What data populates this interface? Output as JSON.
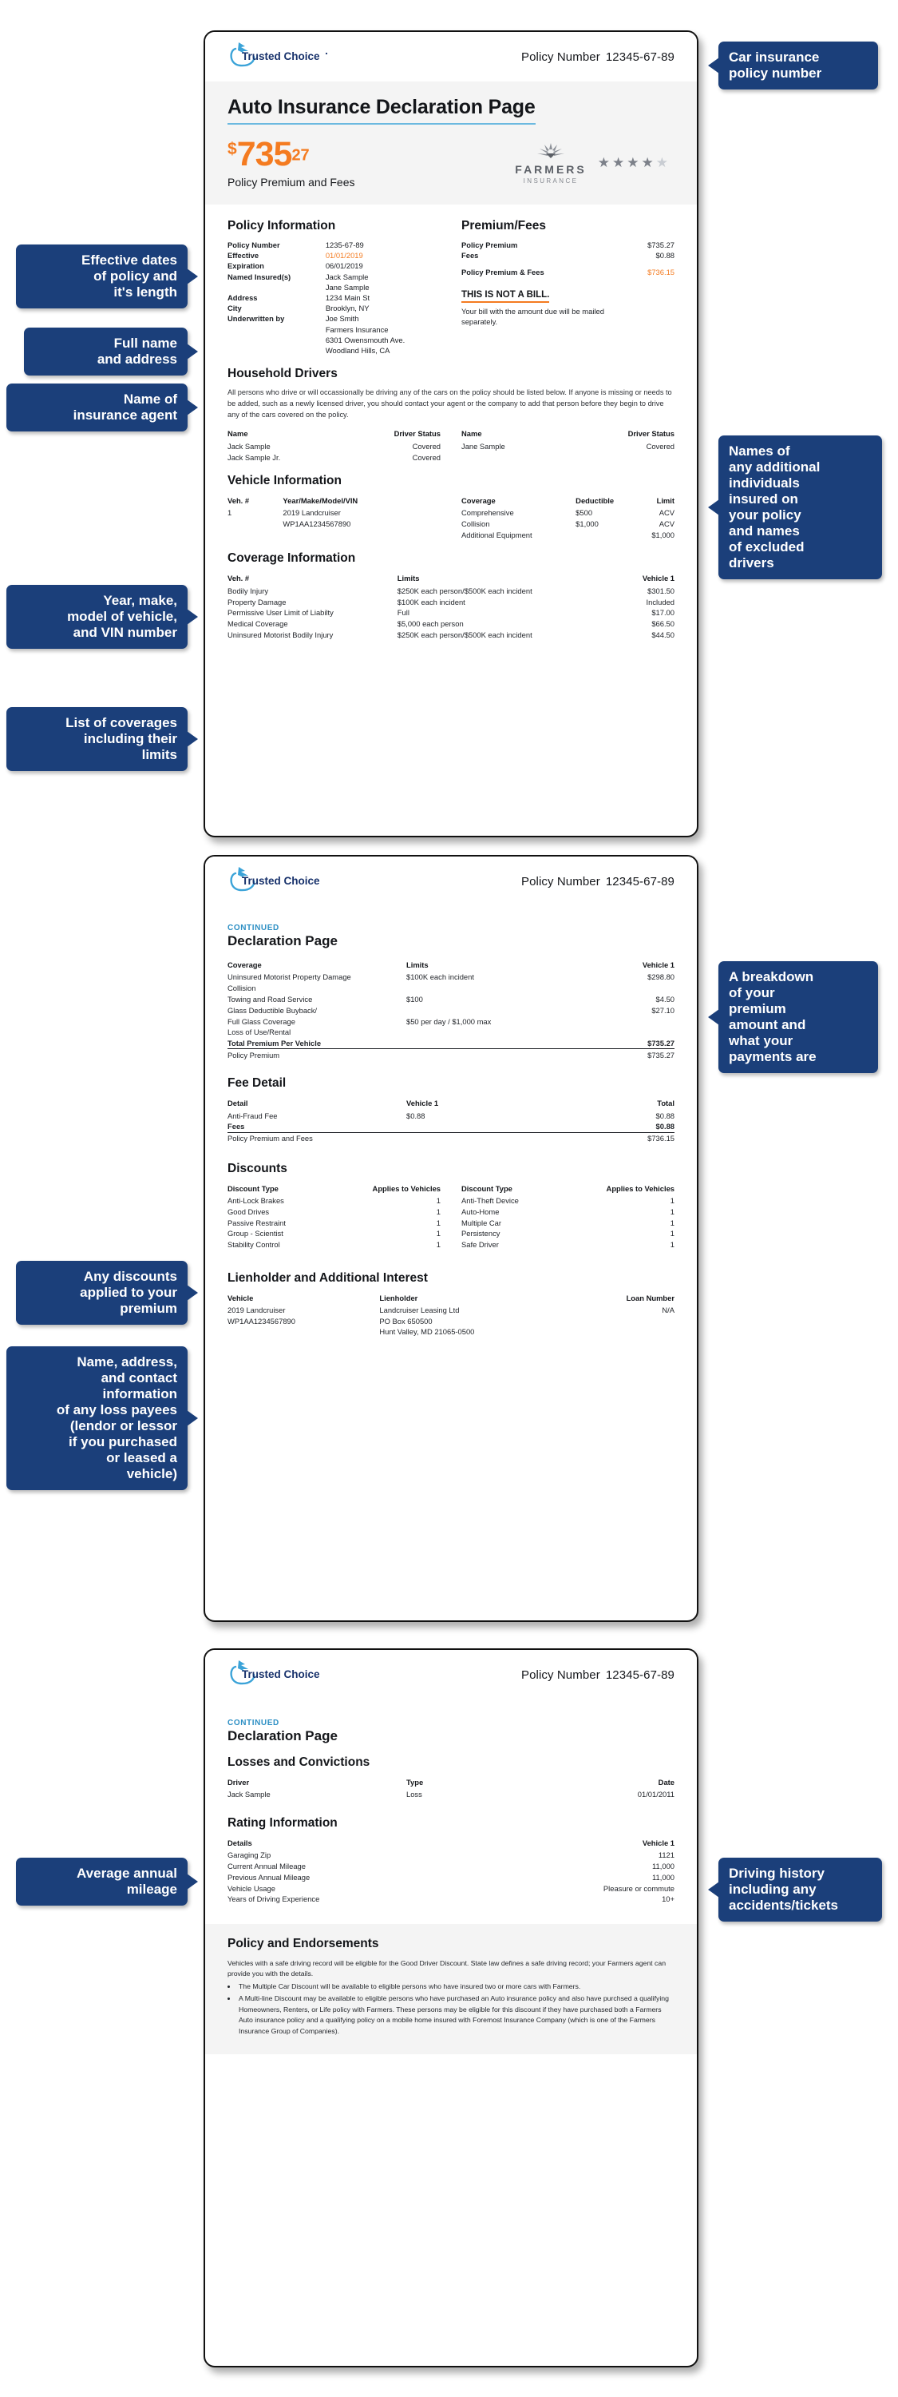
{
  "brand": {
    "logo_text": "Trusted Choice",
    "accent_blue": "#2d8fc4",
    "accent_orange": "#f47b20",
    "callout_navy": "#1b3f7a"
  },
  "page1": {
    "header": {
      "policy_label": "Policy Number",
      "policy_value": "12345-67-89"
    },
    "title": "Auto Insurance Declaration Page",
    "price": {
      "currency": "$",
      "dollars": "735",
      "cents": "27",
      "caption": "Policy Premium and Fees"
    },
    "carrier": {
      "name": "FARMERS",
      "sub": "INSURANCE",
      "rating_filled": 4,
      "rating_total": 5
    },
    "policy_information": {
      "heading": "Policy Information",
      "rows": [
        {
          "label": "Policy Number",
          "value": "1235-67-89",
          "highlight": false
        },
        {
          "label": "Effective",
          "value": "01/01/2019",
          "highlight": true
        },
        {
          "label": "Expiration",
          "value": "06/01/2019",
          "highlight": false
        },
        {
          "label": "Named Insured(s)",
          "value": "Jack Sample",
          "highlight": false
        },
        {
          "label": "",
          "value": "Jane Sample",
          "highlight": false
        },
        {
          "label": "Address",
          "value": "1234 Main St",
          "highlight": false
        },
        {
          "label": "City",
          "value": "Brooklyn, NY",
          "highlight": false
        },
        {
          "label": "Underwritten by",
          "value": "Joe Smith",
          "highlight": false
        },
        {
          "label": "",
          "value": "Farmers Insurance",
          "highlight": false
        },
        {
          "label": "",
          "value": "6301 Owensmouth Ave.",
          "highlight": false
        },
        {
          "label": "",
          "value": "Woodland Hills, CA",
          "highlight": false
        }
      ]
    },
    "premium_fees": {
      "heading": "Premium/Fees",
      "rows": [
        {
          "label": "Policy Premium",
          "value": "$735.27"
        },
        {
          "label": "Fees",
          "value": "$0.88"
        }
      ],
      "total_label": "Policy Premium & Fees",
      "total_value": "$736.15",
      "notice_title": "THIS IS NOT A BILL.",
      "notice_body": "Your bill with the amount due will be mailed separately."
    },
    "household_drivers": {
      "heading": "Household Drivers",
      "note": "All persons who drive or will occassionally be driving any of the cars on the policy should be listed below. If anyone is missing or needs to be added, such as a newly licensed driver, you should contact your agent or the company to add that person before they begin to drive any of the cars covered on the policy.",
      "col_name": "Name",
      "col_status": "Driver Status",
      "left": [
        {
          "name": "Jack Sample",
          "status": "Covered"
        },
        {
          "name": "Jack Sample Jr.",
          "status": "Covered"
        }
      ],
      "right": [
        {
          "name": "Jane Sample",
          "status": "Covered"
        }
      ]
    },
    "vehicle_information": {
      "heading": "Vehicle Information",
      "col_veh": "Veh. #",
      "col_ymmv": "Year/Make/Model/VIN",
      "col_coverage": "Coverage",
      "col_deductible": "Deductible",
      "col_limit": "Limit",
      "veh_number": "1",
      "veh_desc": "2019 Landcruiser",
      "veh_vin": "WP1AA1234567890",
      "coverages": [
        {
          "coverage": "Comprehensive",
          "deductible": "$500",
          "limit": "ACV"
        },
        {
          "coverage": "Collision",
          "deductible": "$1,000",
          "limit": "ACV"
        },
        {
          "coverage": "Additional Equipment",
          "deductible": "",
          "limit": "$1,000"
        }
      ]
    },
    "coverage_information": {
      "heading": "Coverage Information",
      "col_veh": "Veh. #",
      "col_limits": "Limits",
      "col_vehicle1": "Vehicle 1",
      "rows": [
        {
          "coverage": "Bodily Injury",
          "limits": "$250K each person/$500K each incident",
          "v1": "$301.50"
        },
        {
          "coverage": "Property Damage",
          "limits": "$100K each incident",
          "v1": "Included"
        },
        {
          "coverage": "Permissive User Limit of Liabilty",
          "limits": "Full",
          "v1": "$17.00"
        },
        {
          "coverage": "Medical Coverage",
          "limits": "$5,000 each person",
          "v1": "$66.50"
        },
        {
          "coverage": "Uninsured Motorist Bodily Injury",
          "limits": "$250K each person/$500K each incident",
          "v1": "$44.50"
        }
      ]
    }
  },
  "page2": {
    "header": {
      "policy_label": "Policy Number",
      "policy_value": "12345-67-89"
    },
    "continued": "CONTINUED",
    "title": "Declaration Page",
    "coverage_table": {
      "col_coverage": "Coverage",
      "col_limits": "Limits",
      "col_vehicle1": "Vehicle 1",
      "rows": [
        {
          "coverage": "Uninsured Motorist Property Damage",
          "limits": "$100K each incident",
          "v1": "$298.80"
        },
        {
          "coverage": "Collision",
          "limits": "",
          "v1": ""
        },
        {
          "coverage": "Towing and Road Service",
          "limits": "$100",
          "v1": "$4.50"
        },
        {
          "coverage": "Glass Deductible Buyback/",
          "limits": "",
          "v1": "$27.10"
        },
        {
          "coverage": "Full Glass Coverage",
          "limits": "$50 per day / $1,000 max",
          "v1": ""
        },
        {
          "coverage": "Loss of Use/Rental",
          "limits": "",
          "v1": ""
        }
      ],
      "total_label": "Total Premium Per Vehicle",
      "total_value": "$735.27",
      "premium_label": "Policy Premium",
      "premium_value": "$735.27"
    },
    "fee_detail": {
      "heading": "Fee Detail",
      "col_detail": "Detail",
      "col_vehicle1": "Vehicle 1",
      "col_total": "Total",
      "rows": [
        {
          "detail": "Anti-Fraud Fee",
          "v1": "$0.88",
          "total": "$0.88"
        }
      ],
      "fees_label": "Fees",
      "fees_value": "$0.88",
      "grand_label": "Policy Premium and Fees",
      "grand_value": "$736.15"
    },
    "discounts": {
      "heading": "Discounts",
      "col_type": "Discount Type",
      "col_applies": "Applies to Vehicles",
      "left": [
        {
          "type": "Anti-Lock Brakes",
          "applies": "1"
        },
        {
          "type": "Good Drives",
          "applies": "1"
        },
        {
          "type": "Passive Restraint",
          "applies": "1"
        },
        {
          "type": "Group - Scientist",
          "applies": "1"
        },
        {
          "type": "Stability Control",
          "applies": "1"
        }
      ],
      "right": [
        {
          "type": "Anti-Theft Device",
          "applies": "1"
        },
        {
          "type": "Auto-Home",
          "applies": "1"
        },
        {
          "type": "Multiple Car",
          "applies": "1"
        },
        {
          "type": "Persistency",
          "applies": "1"
        },
        {
          "type": "Safe Driver",
          "applies": "1"
        }
      ]
    },
    "lienholder": {
      "heading": "Lienholder and Additional Interest",
      "col_vehicle": "Vehicle",
      "col_lienholder": "Lienholder",
      "col_loan": "Loan Number",
      "vehicle_desc": "2019 Landcruiser",
      "vehicle_vin": "WP1AA1234567890",
      "lienholder_name": "Landcruiser Leasing Ltd",
      "lienholder_addr1": "PO Box 650500",
      "lienholder_addr2": "Hunt Valley, MD  21065-0500",
      "loan_number": "N/A"
    }
  },
  "page3": {
    "header": {
      "policy_label": "Policy Number",
      "policy_value": "12345-67-89"
    },
    "continued": "CONTINUED",
    "title": "Declaration Page",
    "losses": {
      "heading": "Losses and Convictions",
      "col_driver": "Driver",
      "col_type": "Type",
      "col_date": "Date",
      "rows": [
        {
          "driver": "Jack Sample",
          "type": "Loss",
          "date": "01/01/2011"
        }
      ]
    },
    "rating": {
      "heading": "Rating Information",
      "col_details": "Details",
      "col_vehicle1": "Vehicle 1",
      "rows": [
        {
          "label": "Garaging Zip",
          "v1": "1121"
        },
        {
          "label": "Current Annual Mileage",
          "v1": "11,000"
        },
        {
          "label": "Previous Annual Mileage",
          "v1": "11,000"
        },
        {
          "label": "Vehicle Usage",
          "v1": "Pleasure or commute"
        },
        {
          "label": "Years of Driving Experience",
          "v1": "10+"
        }
      ]
    },
    "endorsements": {
      "heading": "Policy and Endorsements",
      "intro": "Vehicles with a safe driving record will be eligible for the Good Driver Discount. State law defines a safe driving record; your Farmers agent can provide you with the details.",
      "bullets": [
        "The Multiple Car Discount will be available to eligible persons who have insured two or more cars with Farmers.",
        "A Multi-line Discount may be available to eligible persons who have purchased an Auto insurance policy and also have purchsed a qualifying Homeowners, Renters, or Life policy with Farmers. These persons may be eligible for this discount if they have purchased both a Farmers Auto insurance policy and a qualifying policy on a mobile home insured with Foremost Insurance Company (which is one of the Farmers Insurance Group of Companies)."
      ]
    }
  },
  "callouts": {
    "policy_number": "Car insurance\npolicy number",
    "effective_dates": "Effective dates\nof policy and\nit's length",
    "full_name": "Full name\nand address",
    "agent_name": "Name of\ninsurance agent",
    "additional_insured": "Names of\nany additional\nindividuals\ninsured on\nyour policy\nand names\nof excluded\ndrivers",
    "vehicle_info": "Year, make,\nmodel of vehicle,\nand VIN number",
    "coverage_list": "List of coverages\nincluding their\nlimits",
    "premium_breakdown": "A breakdown\nof your\npremium\namount and\nwhat your\npayments are",
    "discounts": "Any discounts\napplied to your\npremium",
    "lienholder": "Name, address,\nand contact\ninformation\nof any loss payees\n(lendor or lessor\nif you purchased\nor leased a\nvehicle)",
    "mileage": "Average annual\nmileage",
    "driving_history": "Driving history\nincluding any\naccidents/tickets"
  }
}
